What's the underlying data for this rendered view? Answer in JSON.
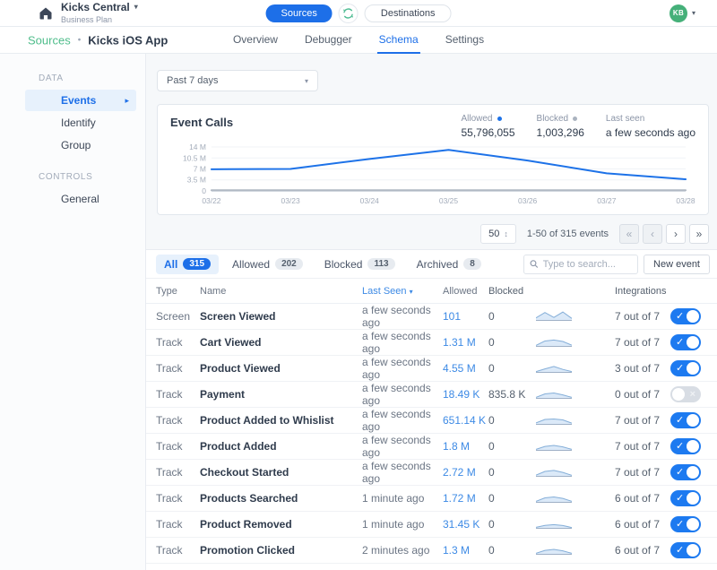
{
  "header": {
    "workspace": "Kicks Central",
    "plan": "Business Plan",
    "env": {
      "sources": "Sources",
      "destinations": "Destinations"
    },
    "avatar": "KB"
  },
  "breadcrumb": {
    "root": "Sources",
    "sep": "•",
    "current": "Kicks iOS App"
  },
  "tabs": [
    {
      "label": "Overview",
      "active": false
    },
    {
      "label": "Debugger",
      "active": false
    },
    {
      "label": "Schema",
      "active": true
    },
    {
      "label": "Settings",
      "active": false
    }
  ],
  "sidebar": {
    "sections": [
      {
        "label": "DATA",
        "items": [
          {
            "label": "Events",
            "active": true
          },
          {
            "label": "Identify",
            "active": false
          },
          {
            "label": "Group",
            "active": false
          }
        ]
      },
      {
        "label": "CONTROLS",
        "items": [
          {
            "label": "General",
            "active": false
          }
        ]
      }
    ]
  },
  "time_filter": {
    "value": "Past 7 days"
  },
  "chart_card": {
    "title": "Event Calls",
    "stats": [
      {
        "label": "Allowed",
        "dot": "#1d72e8",
        "value": "55,796,055"
      },
      {
        "label": "Blocked",
        "dot": "#aab3bf",
        "value": "1,003,296"
      },
      {
        "label": "Last seen",
        "dot": "",
        "value": "a few seconds ago"
      }
    ]
  },
  "chart_data": {
    "type": "line",
    "title": "Event Calls",
    "x": [
      "03/22",
      "03/23",
      "03/24",
      "03/25",
      "03/26",
      "03/27",
      "03/28"
    ],
    "series": [
      {
        "name": "Allowed",
        "color": "#1d72e8",
        "values_millions": [
          6.9,
          7.0,
          10.2,
          13.1,
          9.7,
          5.6,
          3.7
        ]
      },
      {
        "name": "Blocked",
        "color": "#b0b8c4",
        "values_millions": [
          0.2,
          0.2,
          0.2,
          0.2,
          0.2,
          0.2,
          0.2
        ]
      }
    ],
    "y_ticks_millions": [
      0,
      3.5,
      7,
      10.5,
      14
    ],
    "y_tick_labels": [
      "0",
      "3.5 M",
      "7 M",
      "10.5 M",
      "14 M"
    ],
    "ylim_millions": [
      0,
      14
    ],
    "grid": true,
    "legend_position": "top-right"
  },
  "pagination": {
    "page_size": "50",
    "summary": "1-50 of 315 events",
    "buttons": [
      {
        "glyph": "«",
        "name": "first-page-button",
        "enabled": false
      },
      {
        "glyph": "‹",
        "name": "prev-page-button",
        "enabled": false
      },
      {
        "glyph": "›",
        "name": "next-page-button",
        "enabled": true
      },
      {
        "glyph": "»",
        "name": "last-page-button",
        "enabled": true
      }
    ]
  },
  "list": {
    "filters": [
      {
        "label": "All",
        "count": "315",
        "active": true
      },
      {
        "label": "Allowed",
        "count": "202",
        "active": false
      },
      {
        "label": "Blocked",
        "count": "113",
        "active": false
      },
      {
        "label": "Archived",
        "count": "8",
        "active": false
      }
    ],
    "search_placeholder": "Type to search...",
    "new_event_label": "New event",
    "columns": {
      "type": "Type",
      "name": "Name",
      "last_seen": "Last Seen",
      "allowed": "Allowed",
      "blocked": "Blocked",
      "integrations": "Integrations"
    },
    "rows": [
      {
        "type": "Screen",
        "name": "Screen Viewed",
        "last_seen": "a few seconds ago",
        "allowed": "101",
        "blocked": "0",
        "integrations": "7 out of 7",
        "enabled": true,
        "spark": [
          0.25,
          0.8,
          0.3,
          0.85,
          0.2
        ]
      },
      {
        "type": "Track",
        "name": "Cart Viewed",
        "last_seen": "a few seconds ago",
        "allowed": "1.31 M",
        "blocked": "0",
        "integrations": "7 out of 7",
        "enabled": true,
        "spark": [
          0.1,
          0.55,
          0.65,
          0.5,
          0.12
        ]
      },
      {
        "type": "Track",
        "name": "Product Viewed",
        "last_seen": "a few seconds ago",
        "allowed": "4.55 M",
        "blocked": "0",
        "integrations": "3 out of 7",
        "enabled": true,
        "spark": [
          0.08,
          0.35,
          0.6,
          0.3,
          0.08
        ]
      },
      {
        "type": "Track",
        "name": "Payment",
        "last_seen": "a few seconds ago",
        "allowed": "18.49 K",
        "blocked": "835.8 K",
        "integrations": "0 out of 7",
        "enabled": false,
        "spark": [
          0.1,
          0.45,
          0.55,
          0.35,
          0.1
        ]
      },
      {
        "type": "Track",
        "name": "Product Added to Whislist",
        "last_seen": "a few seconds ago",
        "allowed": "651.14 K",
        "blocked": "0",
        "integrations": "7 out of 7",
        "enabled": true,
        "spark": [
          0.15,
          0.5,
          0.55,
          0.45,
          0.12
        ]
      },
      {
        "type": "Track",
        "name": "Product Added",
        "last_seen": "a few seconds ago",
        "allowed": "1.8 M",
        "blocked": "0",
        "integrations": "7 out of 7",
        "enabled": true,
        "spark": [
          0.1,
          0.4,
          0.5,
          0.35,
          0.1
        ]
      },
      {
        "type": "Track",
        "name": "Checkout Started",
        "last_seen": "a few seconds ago",
        "allowed": "2.72 M",
        "blocked": "0",
        "integrations": "7 out of 7",
        "enabled": true,
        "spark": [
          0.12,
          0.5,
          0.6,
          0.4,
          0.1
        ]
      },
      {
        "type": "Track",
        "name": "Products Searched",
        "last_seen": "1 minute ago",
        "allowed": "1.72 M",
        "blocked": "0",
        "integrations": "6 out of 7",
        "enabled": true,
        "spark": [
          0.1,
          0.45,
          0.55,
          0.4,
          0.1
        ]
      },
      {
        "type": "Track",
        "name": "Product Removed",
        "last_seen": "1 minute ago",
        "allowed": "31.45 K",
        "blocked": "0",
        "integrations": "6 out of 7",
        "enabled": true,
        "spark": [
          0.1,
          0.3,
          0.38,
          0.28,
          0.08
        ]
      },
      {
        "type": "Track",
        "name": "Promotion Clicked",
        "last_seen": "2 minutes ago",
        "allowed": "1.3 M",
        "blocked": "0",
        "integrations": "6 out of 7",
        "enabled": true,
        "spark": [
          0.1,
          0.4,
          0.5,
          0.35,
          0.1
        ]
      }
    ]
  },
  "icons": {
    "caret_down": "▾",
    "caret_right": "▸",
    "sort_caret": "▾",
    "updown": "↕",
    "check": "✓",
    "x": "×"
  }
}
